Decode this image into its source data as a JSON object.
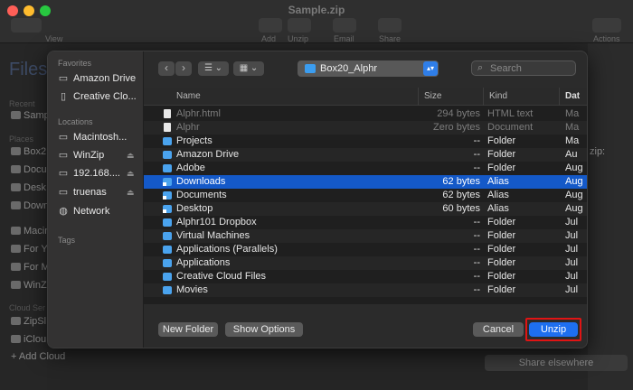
{
  "window": {
    "title": "Sample.zip",
    "toolbar": [
      {
        "label": "View"
      },
      {
        "label": "Add"
      },
      {
        "label": "Unzip"
      },
      {
        "label": "Email"
      },
      {
        "label": "Share"
      },
      {
        "label": "Actions"
      }
    ],
    "colors": {
      "close": "#ff5f57",
      "minimize": "#febc2e",
      "zoom": "#28c840"
    }
  },
  "bg_sidebar": {
    "title": "Files",
    "recent_header": "Recent",
    "recent_items": [
      "Samp"
    ],
    "places_header": "Places",
    "places_items": [
      "Box2",
      "Docu",
      "Desk",
      "Down",
      "Macin",
      "For Y",
      "For M",
      "WinZ"
    ],
    "cloud_header": "Cloud Ser",
    "cloud_items": [
      "ZipSl",
      "iClou"
    ],
    "add_cloud": "Add Cloud"
  },
  "bg_right": {
    "zip_label": "zip:",
    "share_elsewhere": "Share elsewhere"
  },
  "dialog": {
    "sidebar": {
      "favorites_header": "Favorites",
      "favorites": [
        {
          "label": "Amazon Drive",
          "icon": "folder-icon"
        },
        {
          "label": "Creative Clo...",
          "icon": "document-icon"
        }
      ],
      "locations_header": "Locations",
      "locations": [
        {
          "label": "Macintosh...",
          "icon": "hard-drive-icon",
          "eject": false
        },
        {
          "label": "WinZip",
          "icon": "disk-icon",
          "eject": true
        },
        {
          "label": "192.168....",
          "icon": "computer-icon",
          "eject": true
        },
        {
          "label": "truenas",
          "icon": "server-icon",
          "eject": true
        },
        {
          "label": "Network",
          "icon": "globe-icon",
          "eject": false
        }
      ],
      "tags_header": "Tags"
    },
    "path": "Box20_Alphr",
    "search_placeholder": "Search",
    "columns": {
      "name": "Name",
      "size": "Size",
      "kind": "Kind",
      "date": "Dat"
    },
    "files": [
      {
        "name": "Alphr.html",
        "size": "294 bytes",
        "kind": "HTML text",
        "date": "Ma",
        "icon": "doc",
        "dim": true
      },
      {
        "name": "Alphr",
        "size": "Zero bytes",
        "kind": "Document",
        "date": "Ma",
        "icon": "doc",
        "dim": true
      },
      {
        "name": "Projects",
        "size": "--",
        "kind": "Folder",
        "date": "Ma",
        "icon": "folder"
      },
      {
        "name": "Amazon Drive",
        "size": "--",
        "kind": "Folder",
        "date": "Au",
        "icon": "folder"
      },
      {
        "name": "Adobe",
        "size": "--",
        "kind": "Folder",
        "date": "Aug",
        "icon": "folder"
      },
      {
        "name": "Downloads",
        "size": "62 bytes",
        "kind": "Alias",
        "date": "Aug",
        "icon": "alias",
        "selected": true
      },
      {
        "name": "Documents",
        "size": "62 bytes",
        "kind": "Alias",
        "date": "Aug",
        "icon": "alias"
      },
      {
        "name": "Desktop",
        "size": "60 bytes",
        "kind": "Alias",
        "date": "Aug",
        "icon": "alias"
      },
      {
        "name": "Alphr101 Dropbox",
        "size": "--",
        "kind": "Folder",
        "date": "Jul",
        "icon": "folder"
      },
      {
        "name": "Virtual Machines",
        "size": "--",
        "kind": "Folder",
        "date": "Jul",
        "icon": "folder"
      },
      {
        "name": "Applications (Parallels)",
        "size": "--",
        "kind": "Folder",
        "date": "Jul",
        "icon": "folder"
      },
      {
        "name": "Applications",
        "size": "--",
        "kind": "Folder",
        "date": "Jul",
        "icon": "folder"
      },
      {
        "name": "Creative Cloud Files",
        "size": "--",
        "kind": "Folder",
        "date": "Jul",
        "icon": "folder"
      },
      {
        "name": "Movies",
        "size": "--",
        "kind": "Folder",
        "date": "Jul",
        "icon": "folder"
      }
    ],
    "buttons": {
      "new_folder": "New Folder",
      "show_options": "Show Options",
      "cancel": "Cancel",
      "unzip": "Unzip"
    },
    "colors": {
      "accent": "#1e6ff0",
      "selection": "#1459c8",
      "highlight_box": "#e01414"
    }
  }
}
